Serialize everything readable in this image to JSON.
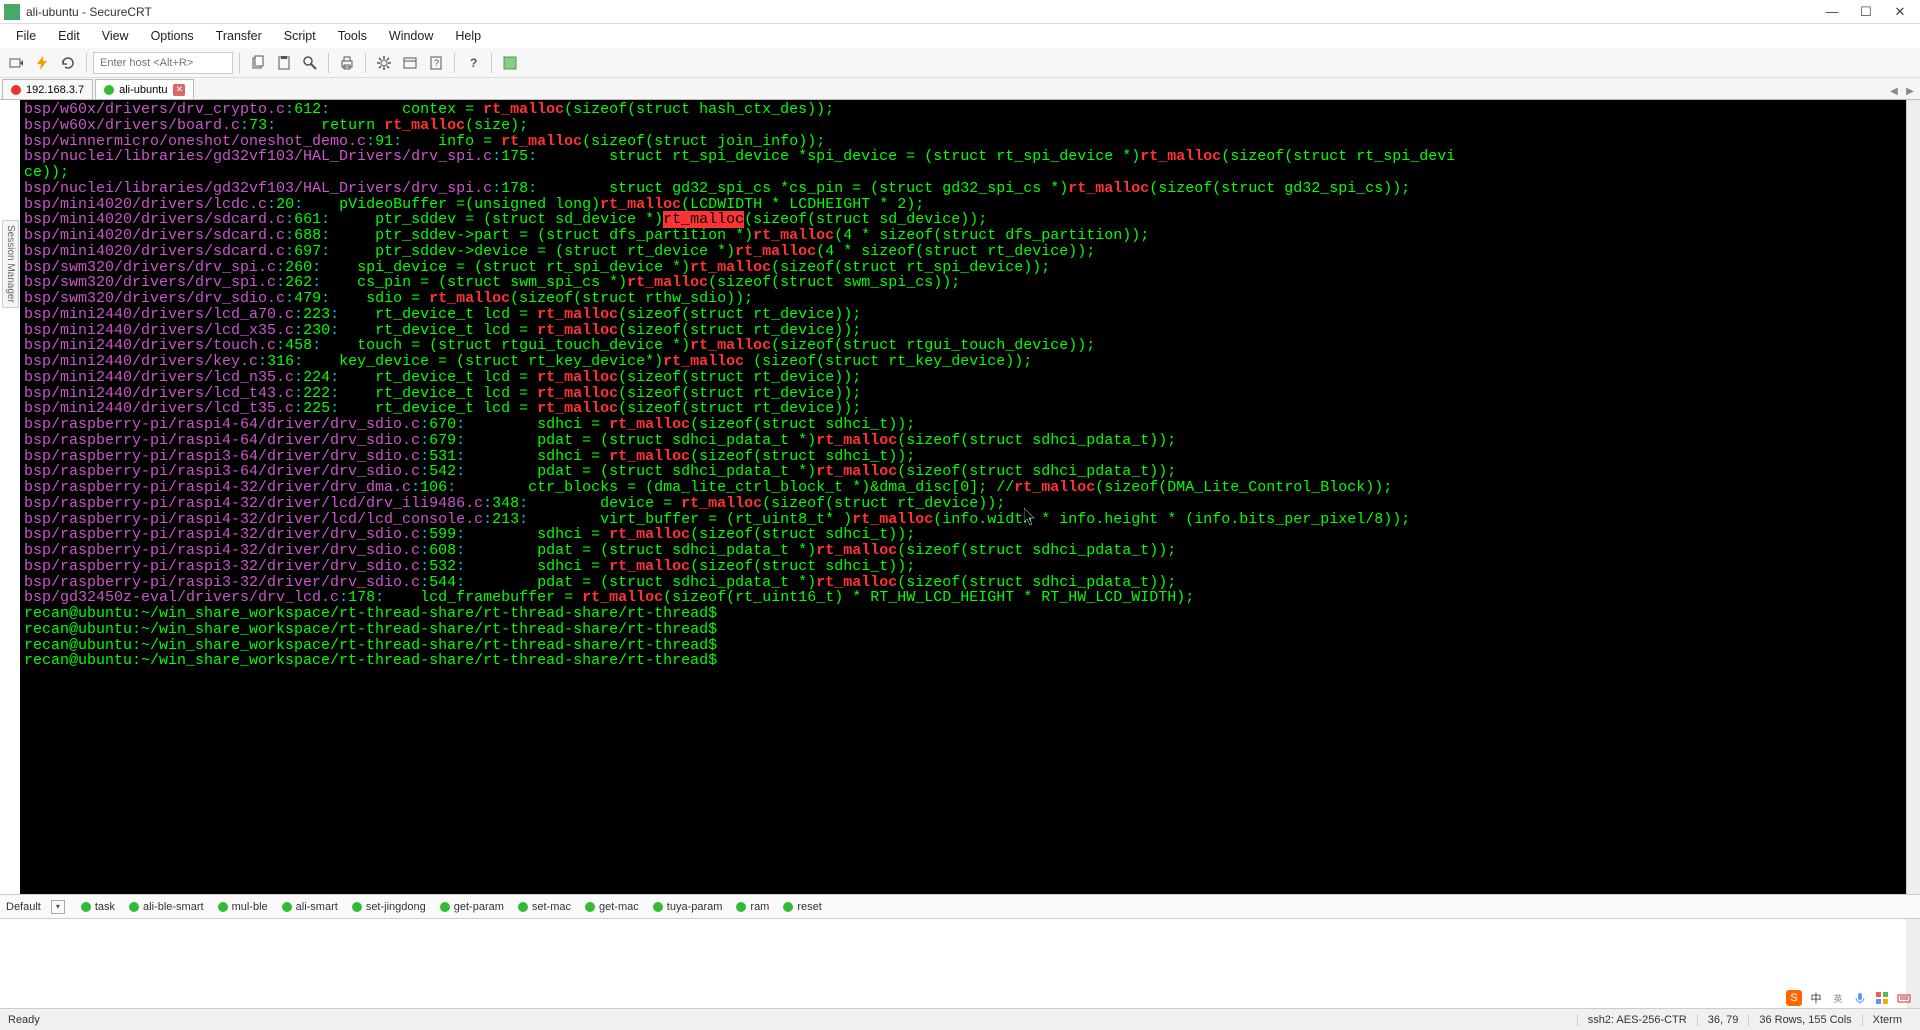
{
  "window": {
    "title": "ali-ubuntu - SecureCRT"
  },
  "menu": {
    "file": "File",
    "edit": "Edit",
    "view": "View",
    "options": "Options",
    "transfer": "Transfer",
    "script": "Script",
    "tools": "Tools",
    "window": "Window",
    "help": "Help"
  },
  "toolbar": {
    "host_placeholder": "Enter host <Alt+R>"
  },
  "tabs": [
    {
      "label": "192.168.3.7",
      "status": "red"
    },
    {
      "label": "ali-ubuntu",
      "status": "green",
      "active": true
    }
  ],
  "sidebar": {
    "label": "Session Manager"
  },
  "terminal_lines": [
    {
      "path": "bsp/w60x/drivers/drv_crypto.c",
      "ln": "612",
      "pre": "        contex = ",
      "mid": "rt_malloc",
      "post": "(sizeof(struct hash_ctx_des));"
    },
    {
      "path": "bsp/w60x/drivers/board.c",
      "ln": "73",
      "pre": "     return ",
      "mid": "rt_malloc",
      "post": "(size);"
    },
    {
      "path": "bsp/winnermicro/oneshot/oneshot_demo.c",
      "ln": "91",
      "pre": "    info = ",
      "mid": "rt_malloc",
      "post": "(sizeof(struct join_info));"
    },
    {
      "path": "bsp/nuclei/libraries/gd32vf103/HAL_Drivers/drv_spi.c",
      "ln": "175",
      "pre": "        struct rt_spi_device *spi_device = (struct rt_spi_device *)",
      "mid": "rt_malloc",
      "post": "(sizeof(struct rt_spi_devi"
    },
    {
      "cont": "ce));"
    },
    {
      "path": "bsp/nuclei/libraries/gd32vf103/HAL_Drivers/drv_spi.c",
      "ln": "178",
      "pre": "        struct gd32_spi_cs *cs_pin = (struct gd32_spi_cs *)",
      "mid": "rt_malloc",
      "post": "(sizeof(struct gd32_spi_cs));"
    },
    {
      "path": "bsp/mini4020/drivers/lcdc.c",
      "ln": "20",
      "pre": "    pVideoBuffer =(unsigned long)",
      "mid": "rt_malloc",
      "post": "(LCDWIDTH * LCDHEIGHT * 2);"
    },
    {
      "path": "bsp/mini4020/drivers/sdcard.c",
      "ln": "661",
      "pre": "     ptr_sddev = (struct sd_device *)",
      "hl": "rt_malloc",
      "post": "(sizeof(struct sd_device));"
    },
    {
      "path": "bsp/mini4020/drivers/sdcard.c",
      "ln": "688",
      "pre": "     ptr_sddev->part = (struct dfs_partition *)",
      "mid": "rt_malloc",
      "post": "(4 * sizeof(struct dfs_partition));"
    },
    {
      "path": "bsp/mini4020/drivers/sdcard.c",
      "ln": "697",
      "pre": "     ptr_sddev->device = (struct rt_device *)",
      "mid": "rt_malloc",
      "post": "(4 * sizeof(struct rt_device));"
    },
    {
      "path": "bsp/swm320/drivers/drv_spi.c",
      "ln": "260",
      "pre": "    spi_device = (struct rt_spi_device *)",
      "mid": "rt_malloc",
      "post": "(sizeof(struct rt_spi_device));"
    },
    {
      "path": "bsp/swm320/drivers/drv_spi.c",
      "ln": "262",
      "pre": "    cs_pin = (struct swm_spi_cs *)",
      "mid": "rt_malloc",
      "post": "(sizeof(struct swm_spi_cs));"
    },
    {
      "path": "bsp/swm320/drivers/drv_sdio.c",
      "ln": "479",
      "pre": "    sdio = ",
      "mid": "rt_malloc",
      "post": "(sizeof(struct rthw_sdio));"
    },
    {
      "path": "bsp/mini2440/drivers/lcd_a70.c",
      "ln": "223",
      "pre": "    rt_device_t lcd = ",
      "mid": "rt_malloc",
      "post": "(sizeof(struct rt_device));"
    },
    {
      "path": "bsp/mini2440/drivers/lcd_x35.c",
      "ln": "230",
      "pre": "    rt_device_t lcd = ",
      "mid": "rt_malloc",
      "post": "(sizeof(struct rt_device));"
    },
    {
      "path": "bsp/mini2440/drivers/touch.c",
      "ln": "458",
      "pre": "    touch = (struct rtgui_touch_device *)",
      "mid": "rt_malloc",
      "post": "(sizeof(struct rtgui_touch_device));"
    },
    {
      "path": "bsp/mini2440/drivers/key.c",
      "ln": "316",
      "pre": "    key_device = (struct rt_key_device*)",
      "mid": "rt_malloc",
      "post": " (sizeof(struct rt_key_device));"
    },
    {
      "path": "bsp/mini2440/drivers/lcd_n35.c",
      "ln": "224",
      "pre": "    rt_device_t lcd = ",
      "mid": "rt_malloc",
      "post": "(sizeof(struct rt_device));"
    },
    {
      "path": "bsp/mini2440/drivers/lcd_t43.c",
      "ln": "222",
      "pre": "    rt_device_t lcd = ",
      "mid": "rt_malloc",
      "post": "(sizeof(struct rt_device));"
    },
    {
      "path": "bsp/mini2440/drivers/lcd_t35.c",
      "ln": "225",
      "pre": "    rt_device_t lcd = ",
      "mid": "rt_malloc",
      "post": "(sizeof(struct rt_device));"
    },
    {
      "path": "bsp/raspberry-pi/raspi4-64/driver/drv_sdio.c",
      "ln": "670",
      "pre": "        sdhci = ",
      "mid": "rt_malloc",
      "post": "(sizeof(struct sdhci_t));"
    },
    {
      "path": "bsp/raspberry-pi/raspi4-64/driver/drv_sdio.c",
      "ln": "679",
      "pre": "        pdat = (struct sdhci_pdata_t *)",
      "mid": "rt_malloc",
      "post": "(sizeof(struct sdhci_pdata_t));"
    },
    {
      "path": "bsp/raspberry-pi/raspi3-64/driver/drv_sdio.c",
      "ln": "531",
      "pre": "        sdhci = ",
      "mid": "rt_malloc",
      "post": "(sizeof(struct sdhci_t));"
    },
    {
      "path": "bsp/raspberry-pi/raspi3-64/driver/drv_sdio.c",
      "ln": "542",
      "pre": "        pdat = (struct sdhci_pdata_t *)",
      "mid": "rt_malloc",
      "post": "(sizeof(struct sdhci_pdata_t));"
    },
    {
      "path": "bsp/raspberry-pi/raspi4-32/driver/drv_dma.c",
      "ln": "106",
      "pre": "        ctr_blocks = (dma_lite_ctrl_block_t *)&dma_disc[0]; //",
      "mid": "rt_malloc",
      "post": "(sizeof(DMA_Lite_Control_Block));"
    },
    {
      "path": "bsp/raspberry-pi/raspi4-32/driver/lcd/drv_ili9486.c",
      "ln": "348",
      "pre": "        device = ",
      "mid": "rt_malloc",
      "post": "(sizeof(struct rt_device));"
    },
    {
      "path": "bsp/raspberry-pi/raspi4-32/driver/lcd/lcd_console.c",
      "ln": "213",
      "pre": "        virt_buffer = (rt_uint8_t* )",
      "mid": "rt_malloc",
      "post": "(info.width * info.height * (info.bits_per_pixel/8));"
    },
    {
      "path": "bsp/raspberry-pi/raspi4-32/driver/drv_sdio.c",
      "ln": "599",
      "pre": "        sdhci = ",
      "mid": "rt_malloc",
      "post": "(sizeof(struct sdhci_t));"
    },
    {
      "path": "bsp/raspberry-pi/raspi4-32/driver/drv_sdio.c",
      "ln": "608",
      "pre": "        pdat = (struct sdhci_pdata_t *)",
      "mid": "rt_malloc",
      "post": "(sizeof(struct sdhci_pdata_t));"
    },
    {
      "path": "bsp/raspberry-pi/raspi3-32/driver/drv_sdio.c",
      "ln": "532",
      "pre": "        sdhci = ",
      "mid": "rt_malloc",
      "post": "(sizeof(struct sdhci_t));"
    },
    {
      "path": "bsp/raspberry-pi/raspi3-32/driver/drv_sdio.c",
      "ln": "544",
      "pre": "        pdat = (struct sdhci_pdata_t *)",
      "mid": "rt_malloc",
      "post": "(sizeof(struct sdhci_pdata_t));"
    },
    {
      "path": "bsp/gd32450z-eval/drivers/drv_lcd.c",
      "ln": "178",
      "pre": "    lcd_framebuffer = ",
      "mid": "rt_malloc",
      "post": "(sizeof(rt_uint16_t) * RT_HW_LCD_HEIGHT * RT_HW_LCD_WIDTH);"
    },
    {
      "prompt": "recan@ubuntu:~/win_share_workspace/rt-thread-share/rt-thread-share/rt-thread$"
    },
    {
      "prompt": "recan@ubuntu:~/win_share_workspace/rt-thread-share/rt-thread-share/rt-thread$"
    },
    {
      "prompt": "recan@ubuntu:~/win_share_workspace/rt-thread-share/rt-thread-share/rt-thread$"
    },
    {
      "prompt": "recan@ubuntu:~/win_share_workspace/rt-thread-share/rt-thread-share/rt-thread$"
    }
  ],
  "quick": {
    "default": "Default",
    "buttons": [
      "task",
      "ali-ble-smart",
      "mul-ble",
      "ali-smart",
      "set-jingdong",
      "get-param",
      "set-mac",
      "get-mac",
      "tuya-param",
      "ram",
      "reset"
    ]
  },
  "status": {
    "ready": "Ready",
    "ssh": "ssh2: AES-256-CTR",
    "cursor": "36,  79",
    "size": "36 Rows, 155 Cols",
    "term": "Xterm"
  },
  "tray": {
    "s": "S",
    "zh": "中",
    "en": "英"
  }
}
